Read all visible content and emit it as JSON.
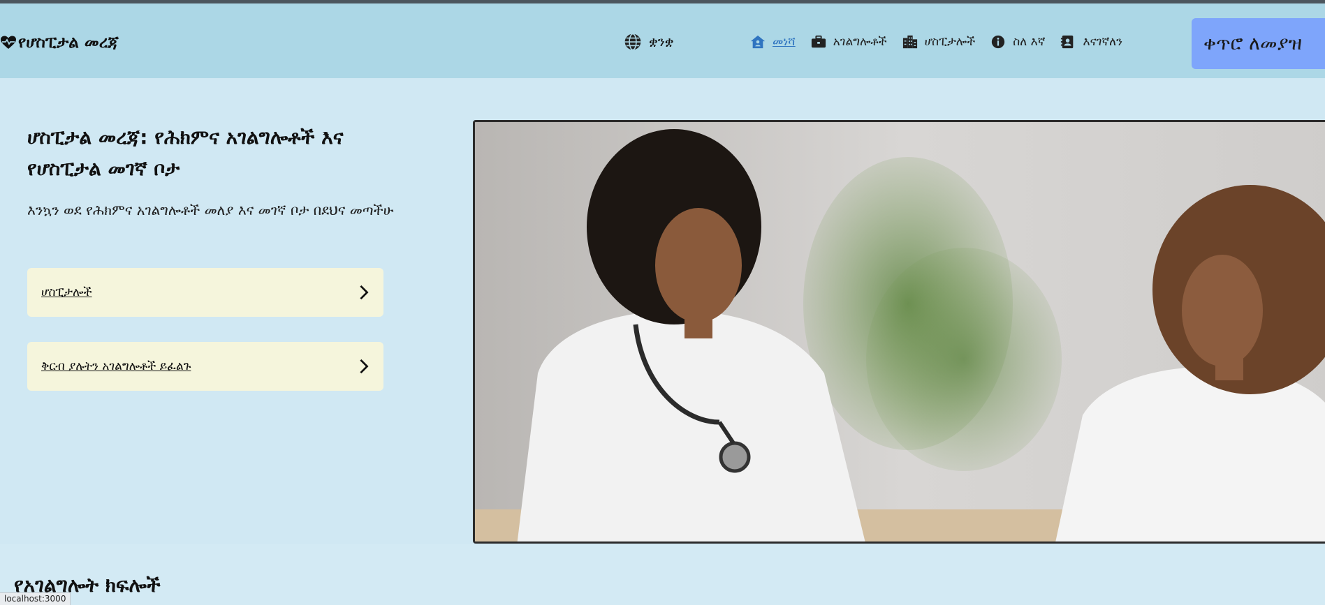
{
  "brand": {
    "title": "የሆስፒታል መረጃ",
    "icon": "heart-pulse-icon"
  },
  "language": {
    "label": "ቋንቋ",
    "icon": "globe-icon"
  },
  "nav": {
    "items": [
      {
        "label": "መነሻ",
        "icon": "home-icon",
        "active": true
      },
      {
        "label": "አገልግሎቶች",
        "icon": "briefcase-icon"
      },
      {
        "label": "ሆስፒታሎች",
        "icon": "building-icon"
      },
      {
        "label": "ስለ እኛ",
        "icon": "info-circle-icon"
      },
      {
        "label": "እናገኛለን",
        "icon": "contact-card-icon"
      }
    ],
    "cta_label": "ቀጥሮ ለመያዝ"
  },
  "hero": {
    "title": "ሆስፒታል መረጃ: የሕክምና አገልግሎቶች እና የሆስፒታል መገኛ ቦታ",
    "subtitle": "እንኳን ወደ የሕክምና አገልግሎቶች መለያ እና መገኛ ቦታ በደህና መጣችሁ",
    "buttons": [
      {
        "label": "ሆስፒታሎች",
        "icon": "chevron-right-icon"
      },
      {
        "label": "ቅርብ ያሉትን አገልግሎቶች ይፈልጉ",
        "icon": "chevron-right-icon"
      }
    ],
    "image": "doctor-consulting-patient-photo"
  },
  "services_section": {
    "title": "የአገልግሎት ክፍሎች"
  },
  "status_bar": {
    "url": "localhost:3000"
  },
  "colors": {
    "navbar_bg": "#acd7e6",
    "page_bg": "#d0e8f3",
    "cta_bg": "#7ea5fb",
    "hero_button_bg": "#f5f5dc",
    "active_link": "#2f74c0"
  }
}
